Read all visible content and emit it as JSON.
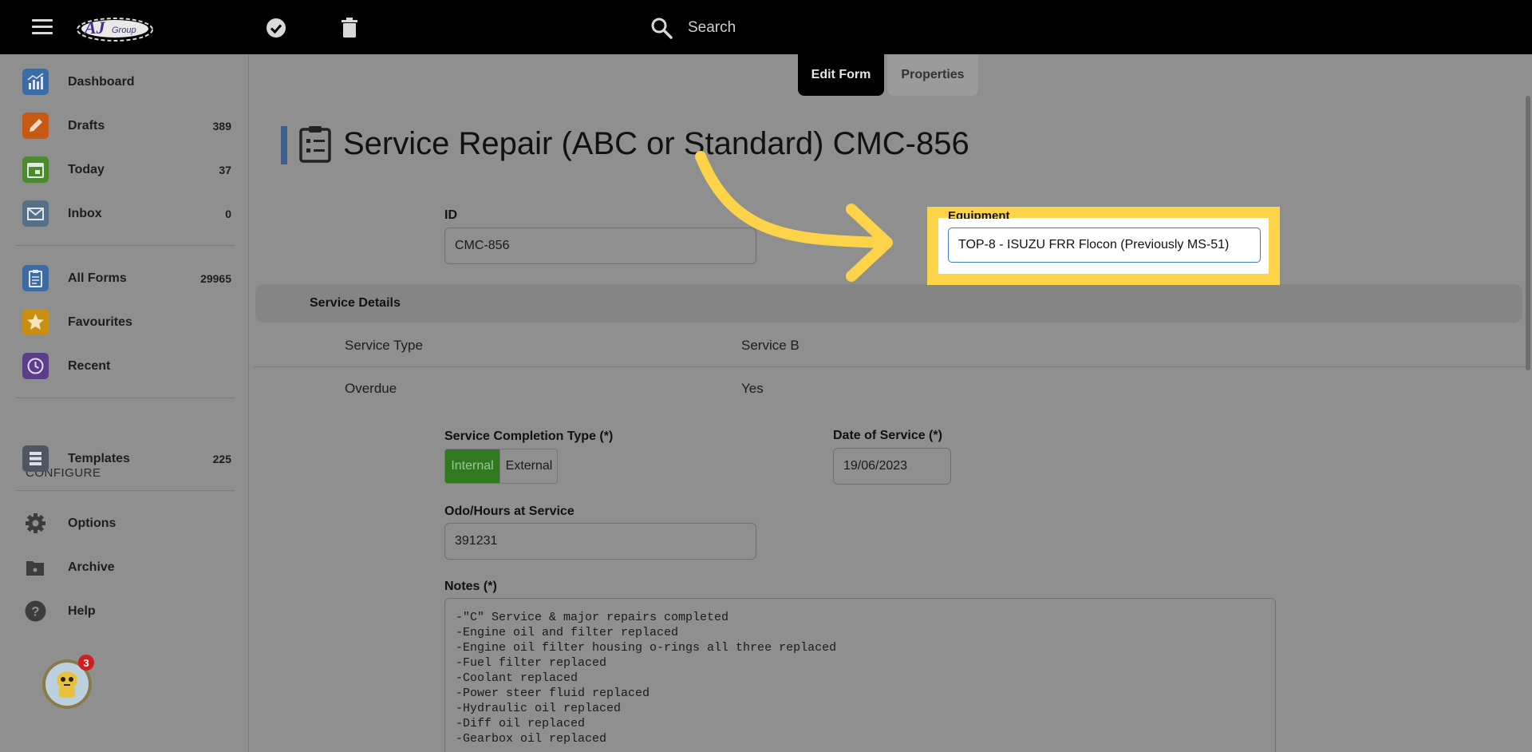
{
  "topbar": {
    "search_placeholder": "Search",
    "logo_text": "AJ Group"
  },
  "sidebar": {
    "items": [
      {
        "label": "Dashboard",
        "count": "",
        "color": "#3d6ba3"
      },
      {
        "label": "Drafts",
        "count": "389",
        "color": "#c65a14"
      },
      {
        "label": "Today",
        "count": "37",
        "color": "#4b8a2e"
      },
      {
        "label": "Inbox",
        "count": "0",
        "color": "#56708a"
      },
      {
        "label": "All Forms",
        "count": "29965",
        "color": "#3d6ba3"
      },
      {
        "label": "Favourites",
        "count": "",
        "color": "#c98f12"
      },
      {
        "label": "Recent",
        "count": "",
        "color": "#5b3e8a"
      },
      {
        "label": "Templates",
        "count": "225",
        "color": "#4e5660"
      },
      {
        "label": "Options",
        "count": "",
        "color": "#3c3c3c"
      },
      {
        "label": "Archive",
        "count": "",
        "color": "#3c3c3c"
      },
      {
        "label": "Help",
        "count": "",
        "color": "#3c3c3c"
      }
    ],
    "configure_label": "CONFIGURE",
    "assistant_badge": "3"
  },
  "tabs": {
    "edit_form": "Edit Form",
    "properties": "Properties"
  },
  "form": {
    "title": "Service Repair (ABC or Standard) CMC-856",
    "id_label": "ID",
    "id_value": "CMC-856",
    "equipment_label": "Equipment",
    "equipment_value": "TOP-8 - ISUZU FRR Flocon (Previously MS-51)",
    "section_title": "Service Details",
    "service_type_label": "Service Type",
    "service_type_value": "Service B",
    "overdue_label": "Overdue",
    "overdue_value": "Yes",
    "completion_label": "Service Completion Type (*)",
    "completion_options": [
      "Internal",
      "External"
    ],
    "date_label": "Date of Service (*)",
    "date_value": "19/06/2023",
    "odo_label": "Odo/Hours at Service",
    "odo_value": "391231",
    "notes_label": "Notes (*)",
    "notes_value": "-\"C\" Service & major repairs completed\n-Engine oil and filter replaced\n-Engine oil filter housing o-rings all three replaced\n-Fuel filter replaced\n-Coolant replaced\n-Power steer fluid replaced\n-Hydraulic oil replaced\n-Diff oil replaced\n-Gearbox oil replaced"
  },
  "colors": {
    "highlight": "#fdd34a",
    "arrow": "#fdd34a",
    "internal_selected": "#2f7a1e"
  }
}
